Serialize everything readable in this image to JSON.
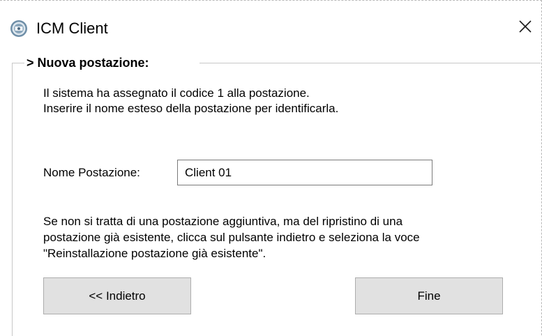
{
  "window": {
    "title": "ICM Client",
    "app_icon": "icm-app-icon",
    "close_icon": "close-icon"
  },
  "group": {
    "title": "> Nuova postazione:"
  },
  "intro": {
    "line1": "Il sistema ha assegnato il codice 1 alla postazione.",
    "line2": "Inserire il nome esteso della postazione per identificarla."
  },
  "form": {
    "name_label": "Nome Postazione:",
    "name_value": "Client 01"
  },
  "note": {
    "line1": "Se non si tratta di una postazione aggiuntiva, ma del ripristino di una",
    "line2": "postazione già esistente, clicca sul pulsante indietro e seleziona la voce",
    "line3": "\"Reinstallazione postazione già esistente\"."
  },
  "buttons": {
    "back_label": "<< Indietro",
    "finish_label": "Fine"
  }
}
